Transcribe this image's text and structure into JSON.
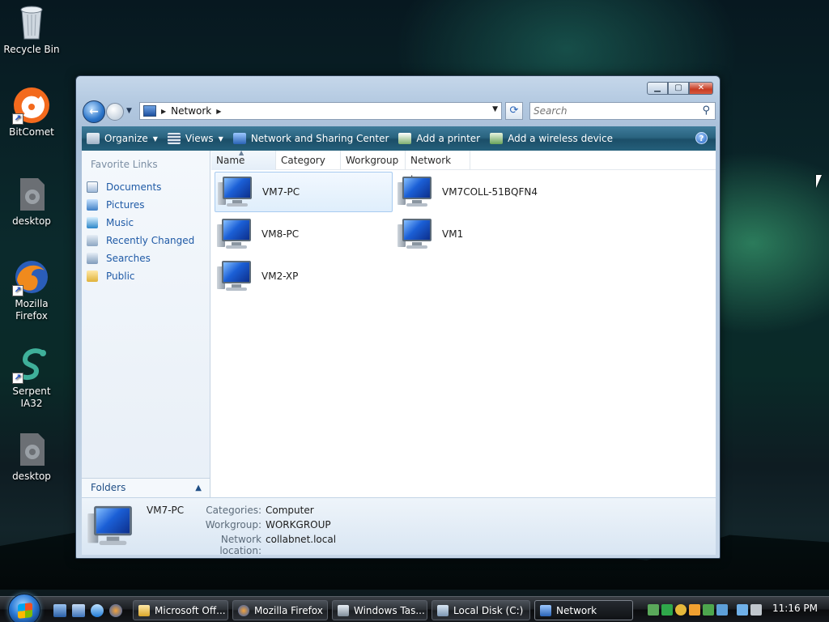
{
  "desktop": {
    "icons": [
      {
        "label": "Recycle Bin",
        "icon": "recycle-bin-icon"
      },
      {
        "label": "BitComet",
        "icon": "bitcomet-icon"
      },
      {
        "label": "desktop",
        "icon": "gear-file-icon"
      },
      {
        "label": "Mozilla Firefox",
        "icon": "firefox-icon"
      },
      {
        "label": "Serpent IA32",
        "icon": "serpent-icon"
      },
      {
        "label": "desktop",
        "icon": "gear-file-icon"
      }
    ]
  },
  "window": {
    "address": {
      "crumb": "Network"
    },
    "search": {
      "placeholder": "Search"
    },
    "toolbar": {
      "organize": "Organize",
      "views": "Views",
      "network_sharing": "Network and Sharing Center",
      "add_printer": "Add a printer",
      "add_wireless": "Add a wireless device"
    },
    "nav_pane": {
      "title": "Favorite Links",
      "links": [
        "Documents",
        "Pictures",
        "Music",
        "Recently Changed",
        "Searches",
        "Public"
      ],
      "folders": "Folders"
    },
    "columns": [
      "Name",
      "Category",
      "Workgroup",
      "Network lo..."
    ],
    "items": [
      "VM7-PC",
      "VM7COLL-51BQFN4",
      "VM8-PC",
      "VM1",
      "VM2-XP"
    ],
    "selected_item": "VM7-PC",
    "details": {
      "name": "VM7-PC",
      "rows": [
        {
          "key": "Categories:",
          "value": "Computer"
        },
        {
          "key": "Workgroup:",
          "value": "WORKGROUP"
        },
        {
          "key": "Network location:",
          "value": "collabnet.local"
        }
      ]
    }
  },
  "taskbar": {
    "buttons": [
      "Microsoft Off...",
      "Mozilla Firefox",
      "Windows Tas...",
      "Local Disk (C:)",
      "Network"
    ],
    "active": "Network",
    "clock": "11:16 PM"
  },
  "colors": {
    "toolbar": "#2a6480",
    "link": "#1f5aa6",
    "selection": "#dfeefc"
  }
}
